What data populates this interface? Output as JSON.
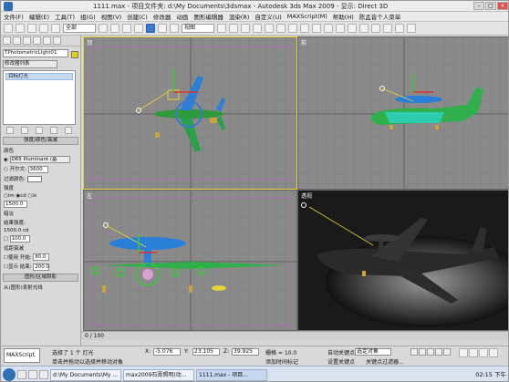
{
  "window": {
    "title": "1111.max - 项目文件夹: d:\\My Documents\\3dsmax - Autodesk 3ds Max 2009 - 显示: Direct 3D"
  },
  "menubar": {
    "items": [
      "文件(F)",
      "编辑(E)",
      "工具(T)",
      "组(G)",
      "视图(V)",
      "创建(C)",
      "修改器",
      "动画",
      "图形编辑器",
      "渲染(R)",
      "自定义(U)",
      "MAXScript(M)",
      "帮助(H)",
      "陈孟皆个人菜单"
    ]
  },
  "toolbar": {
    "selection_filter": "全部",
    "coord_system": "视图"
  },
  "command_panel": {
    "object_name": "TPhotometricLight01",
    "object_color": "#e8d000",
    "modifier_list": "修改器列表",
    "stack_item": "目标灯光",
    "rollout_intensity": "强度/颜色/衰减",
    "color_label": "颜色",
    "color_preset": "D65 Illuminant (基",
    "kelvin_label": "开尔文:",
    "kelvin_value": "3600",
    "filter_color_label": "过滤颜色:",
    "intensity_label": "强度",
    "unit_lm": "lm",
    "unit_cd": "cd",
    "unit_lx": "lx",
    "intensity_value": "1500.0",
    "dimming_label": "暗淡",
    "result_intensity_label": "结果强度:",
    "result_intensity_value": "1500.0 cd",
    "dim_percent": "100.0",
    "far_atten_label": "远距衰减",
    "use_label": "使用",
    "start_label": "开始:",
    "start_value": "80.0",
    "show_label": "显示",
    "end_label": "结束:",
    "end_value": "200.0",
    "shape_rollout": "图形/区域阴影",
    "emit_label": "从(图形)发射光线"
  },
  "viewports": {
    "top": {
      "label": "顶"
    },
    "front": {
      "label": "前"
    },
    "left": {
      "label": "左"
    },
    "perspective": {
      "label": "透视"
    }
  },
  "trackbar": {
    "frame": "0 / 100"
  },
  "status": {
    "maxscript": "MAXScript.",
    "selection": "选择了 1 个 灯光",
    "prompt": "单击并拖动以选择并移动对象",
    "x_value": "-5.076",
    "y_value": "23.105",
    "z_value": "39.925",
    "grid": "栅格 = 10.0",
    "add_time_tag": "添加时间标记",
    "auto_key": "自动关键点",
    "set_key": "设置关键点",
    "selected_obj": "选定对象",
    "key_filters": "关键点过滤器..."
  },
  "taskbar": {
    "tasks": [
      "d:\\My Documents\\My ...",
      "max2009石膏照明(动...",
      "1111.max - 项目..."
    ],
    "time": "02:15 下午"
  }
}
